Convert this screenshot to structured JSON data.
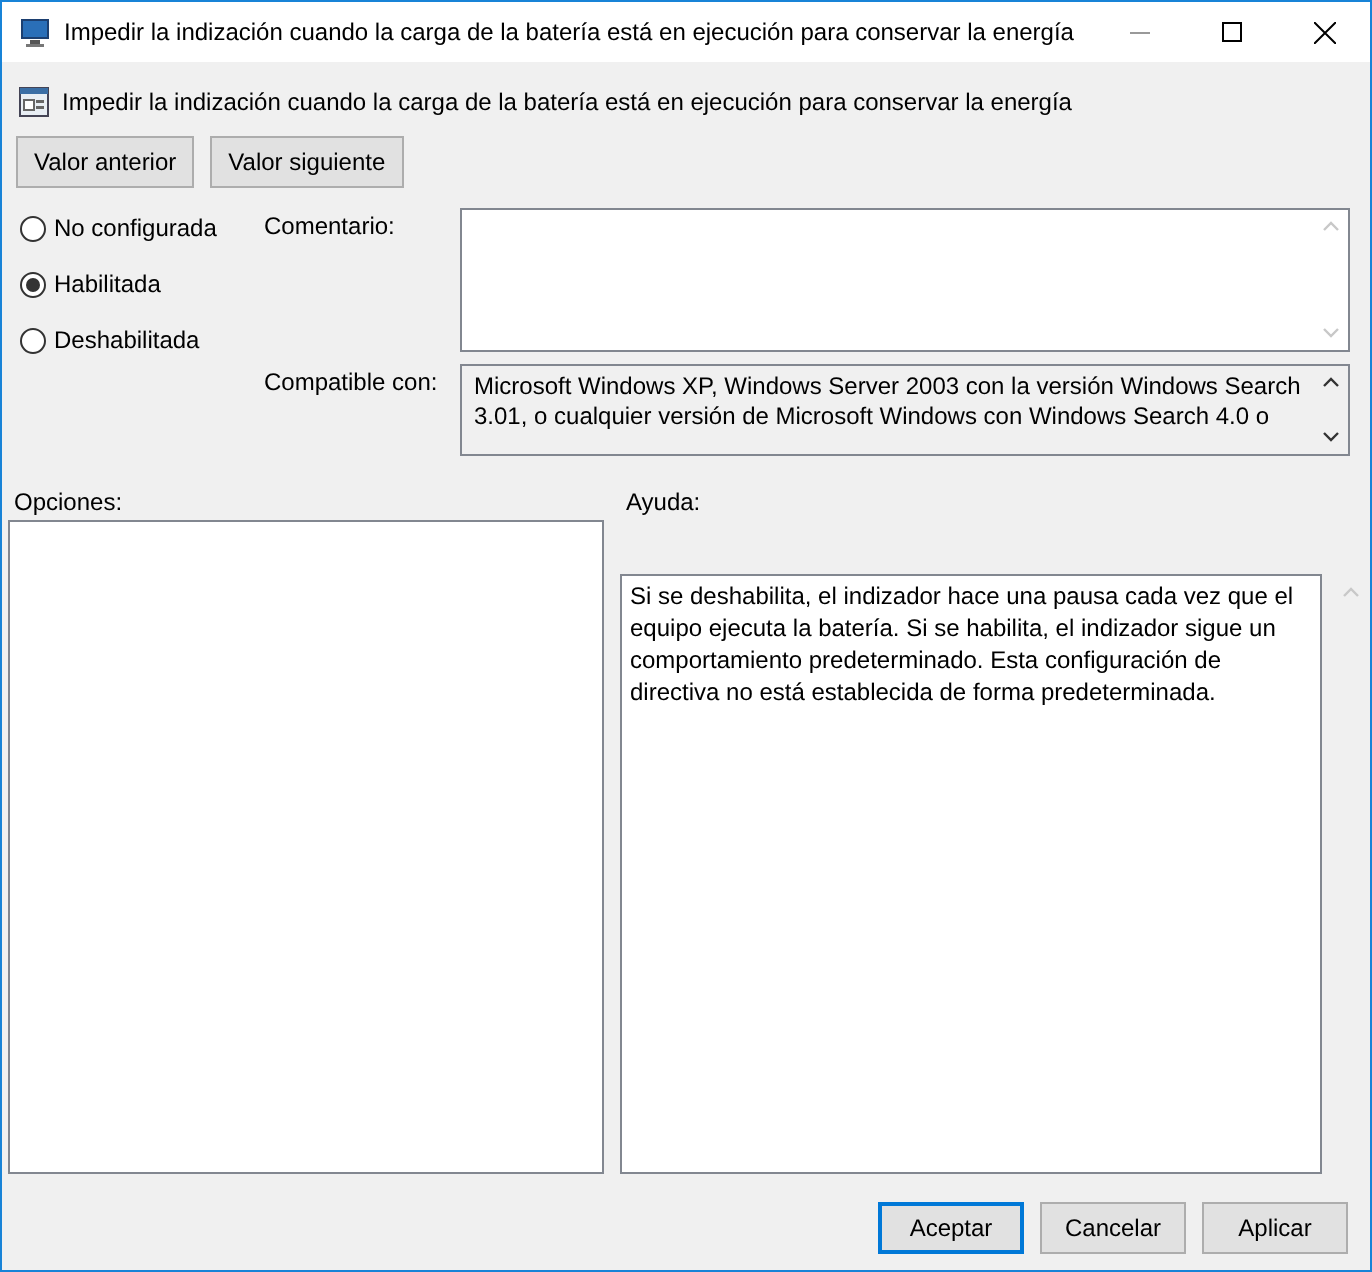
{
  "window": {
    "title": "Impedir la indización cuando la carga de la batería está en ejecución para conservar la energía"
  },
  "header": {
    "title": "Impedir la indización cuando la carga de la batería está en ejecución para conservar la energía"
  },
  "nav_buttons": [
    "Valor anterior",
    "Valor siguiente"
  ],
  "options": [
    {
      "label": "No configurada",
      "selected": false
    },
    {
      "label": "Habilitada",
      "selected": true
    },
    {
      "label": "Deshabilitada",
      "selected": false
    }
  ],
  "comment": {
    "label": "Comentario:"
  },
  "compatible": {
    "label": "Compatible con:",
    "lines": [
      "Microsoft Windows XP, Windows Server 2003 con la versión Windows Search",
      "3.01, o cualquier versión de Microsoft Windows con Windows Search 4.0 o"
    ]
  },
  "options_panel": {
    "label": "Opciones:"
  },
  "help_panel": {
    "label": "Ayuda:",
    "lines": [
      "Si se deshabilita, el indizador hace una pausa cada vez que el",
      "equipo ejecuta la batería. Si se habilita, el indizador sigue un",
      "comportamiento predeterminado. Esta configuración de",
      "directiva no está establecida de forma predeterminada."
    ]
  },
  "buttons": [
    {
      "label": "Aceptar",
      "default": true
    },
    {
      "label": "Cancelar",
      "default": false
    },
    {
      "label": "Aplicar",
      "default": false
    }
  ]
}
